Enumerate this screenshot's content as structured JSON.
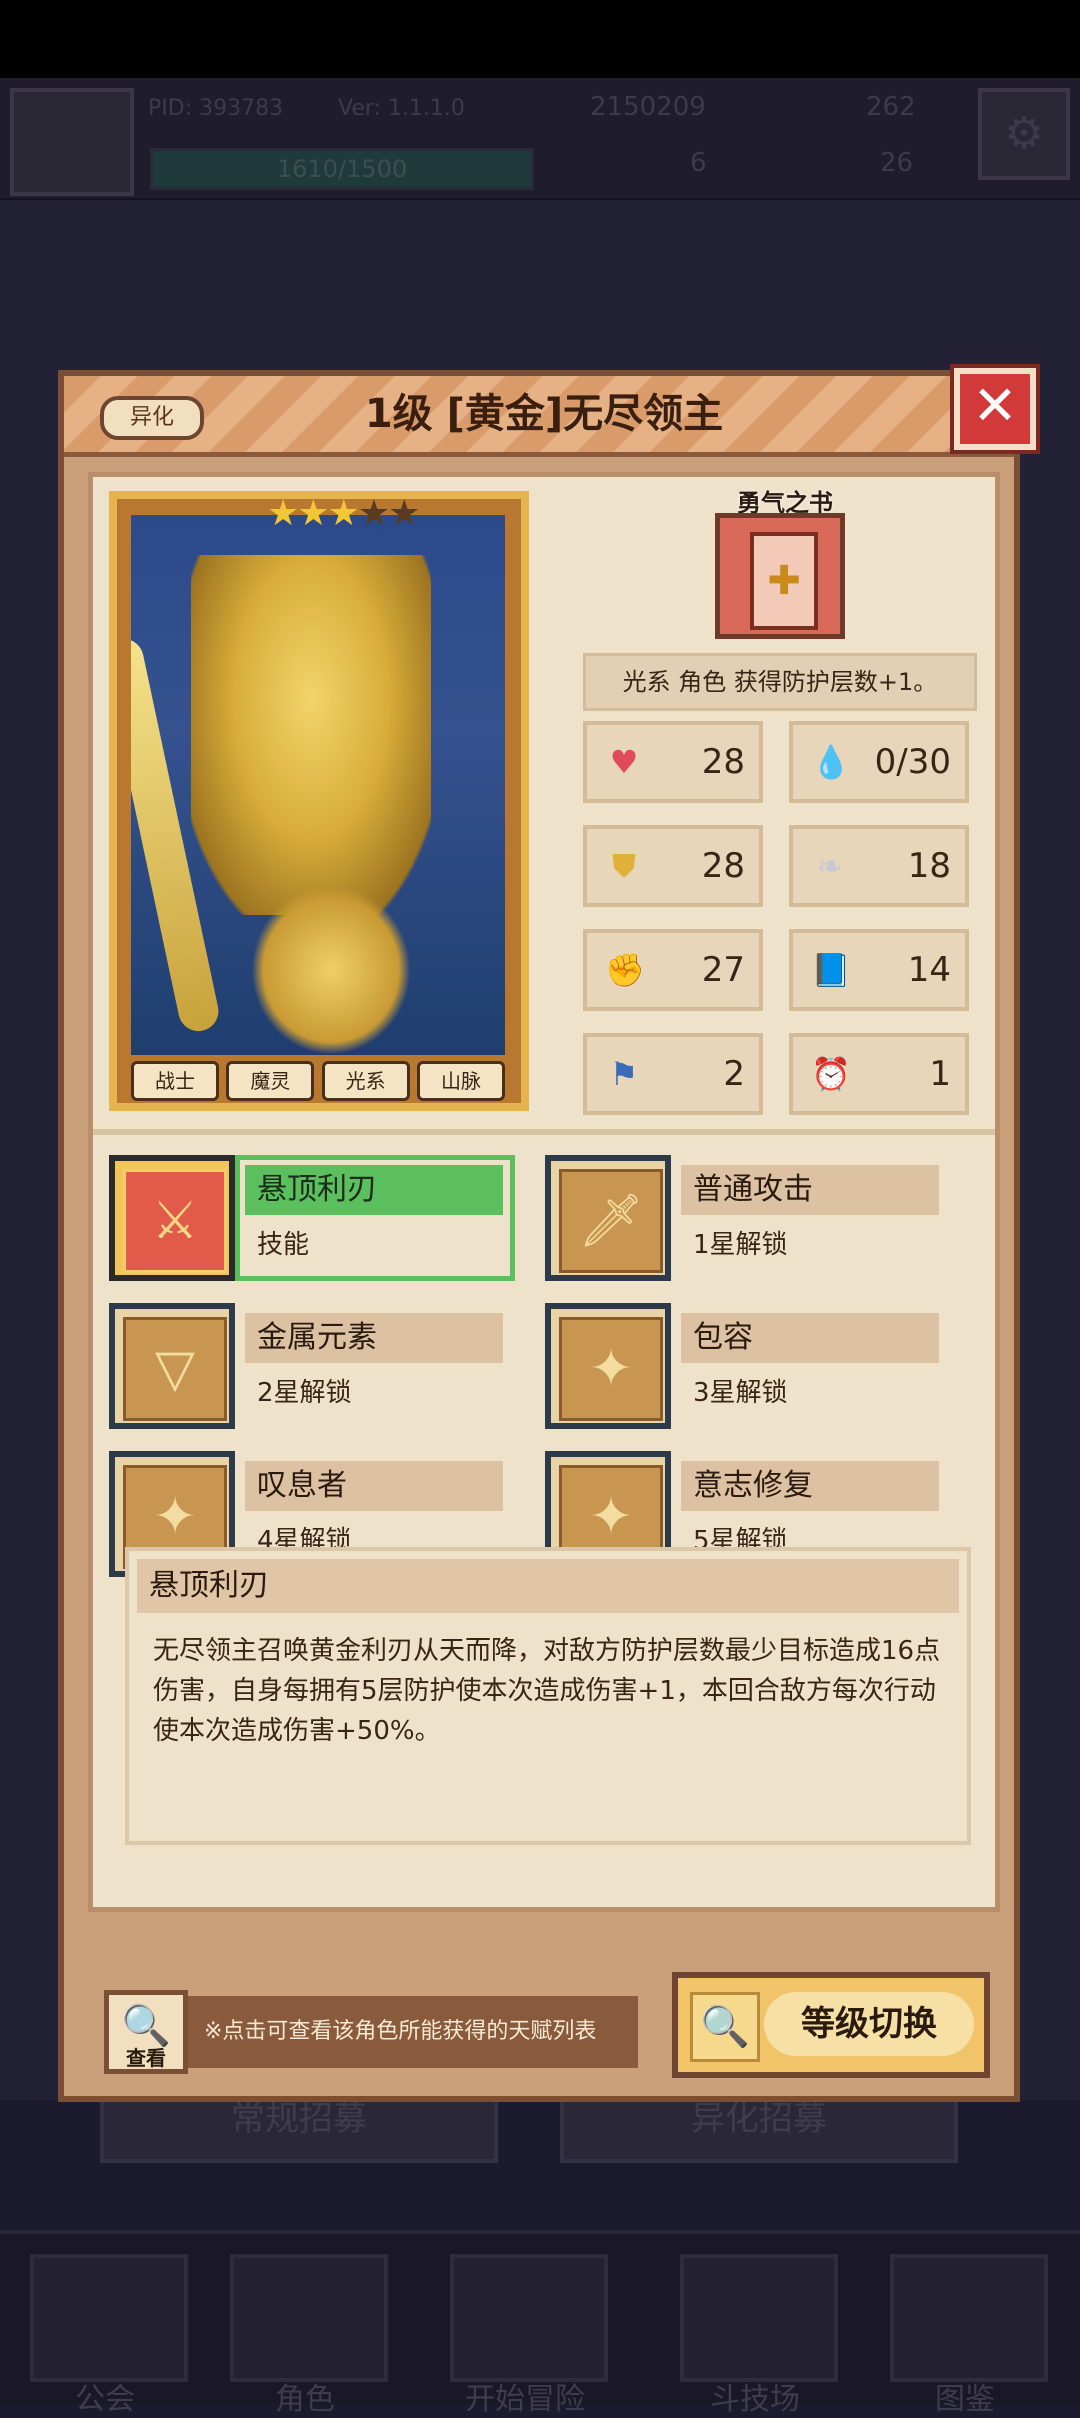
{
  "hud": {
    "pid": "PID: 393783",
    "version": "Ver: 1.1.1.0",
    "coins": "2150209",
    "gems": "262",
    "energy": "1610/1500",
    "resource_a": "6",
    "resource_b": "26"
  },
  "background": {
    "recruit_normal": "常规招募",
    "recruit_variant": "异化招募",
    "nav": [
      "公会",
      "角色",
      "开始冒险",
      "斗技场",
      "图鉴"
    ]
  },
  "modal": {
    "tag": "异化",
    "title": "1级 [黄金]无尽领主",
    "close_icon": "close-icon",
    "stars": {
      "filled": 3,
      "total": 5
    },
    "traits": [
      "战士",
      "魔灵",
      "光系",
      "山脉"
    ],
    "book_label": "勇气之书",
    "effect": "光系 角色 获得防护层数+1。",
    "stats": [
      {
        "icon": "heart-icon",
        "value": "28"
      },
      {
        "icon": "drop-icon",
        "value": "0/30"
      },
      {
        "icon": "shield-icon",
        "value": "28"
      },
      {
        "icon": "wing-icon",
        "value": "18"
      },
      {
        "icon": "fist-icon",
        "value": "27"
      },
      {
        "icon": "book-icon",
        "value": "14"
      },
      {
        "icon": "flag-icon",
        "value": "2"
      },
      {
        "icon": "clock-icon",
        "value": "1"
      }
    ],
    "skills": [
      {
        "name": "悬顶利刃",
        "sub": "技能"
      },
      {
        "name": "普通攻击",
        "sub": "1星解锁"
      },
      {
        "name": "金属元素",
        "sub": "2星解锁"
      },
      {
        "name": "包容",
        "sub": "3星解锁"
      },
      {
        "name": "叹息者",
        "sub": "4星解锁"
      },
      {
        "name": "意志修复",
        "sub": "5星解锁"
      }
    ],
    "desc_title": "悬顶利刃",
    "desc_text": "无尽领主召唤黄金利刃从天而降，对敌方防护层数最少目标造成16点伤害，自身每拥有5层防护使本次造成伤害+1，本回合敌方每次行动使本次造成伤害+50%。",
    "view_label": "查看",
    "hint": "※点击可查看该角色所能获得的天赋列表",
    "switch_label": "等级切换"
  },
  "colors": {
    "accent_green": "#5cbf5e",
    "close_red": "#d23a3a",
    "gold": "#f3c63a"
  }
}
